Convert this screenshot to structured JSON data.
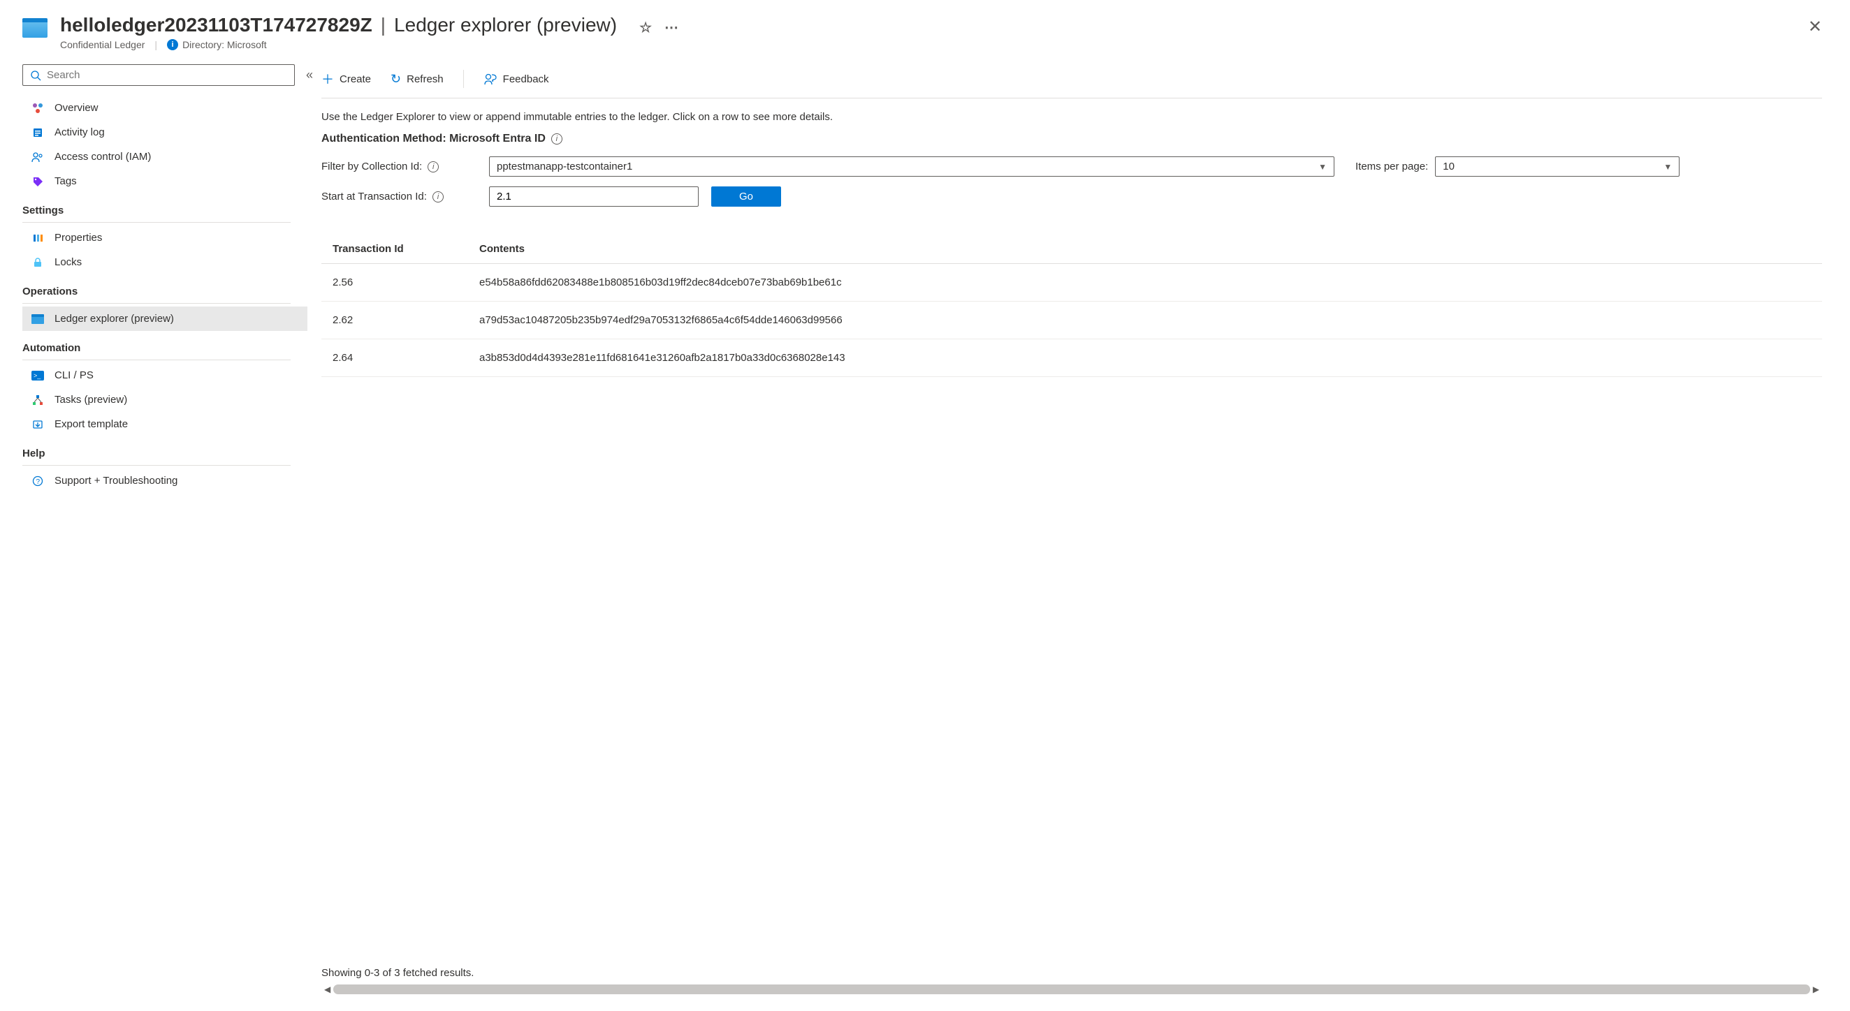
{
  "header": {
    "resource_name": "helloledger20231103T174727829Z",
    "page_name": "Ledger explorer (preview)",
    "resource_type": "Confidential Ledger",
    "directory_label": "Directory: Microsoft"
  },
  "sidebar": {
    "search_placeholder": "Search",
    "items_top": [
      {
        "label": "Overview"
      },
      {
        "label": "Activity log"
      },
      {
        "label": "Access control (IAM)"
      },
      {
        "label": "Tags"
      }
    ],
    "section_settings": "Settings",
    "items_settings": [
      {
        "label": "Properties"
      },
      {
        "label": "Locks"
      }
    ],
    "section_operations": "Operations",
    "items_operations": [
      {
        "label": "Ledger explorer (preview)"
      }
    ],
    "section_automation": "Automation",
    "items_automation": [
      {
        "label": "CLI / PS"
      },
      {
        "label": "Tasks (preview)"
      },
      {
        "label": "Export template"
      }
    ],
    "section_help": "Help",
    "items_help": [
      {
        "label": "Support + Troubleshooting"
      }
    ]
  },
  "toolbar": {
    "create": "Create",
    "refresh": "Refresh",
    "feedback": "Feedback"
  },
  "main": {
    "description": "Use the Ledger Explorer to view or append immutable entries to the ledger. Click on a row to see more details.",
    "auth_label": "Authentication Method: Microsoft Entra ID",
    "filter_collection_label": "Filter by Collection Id:",
    "filter_collection_value": "pptestmanapp-testcontainer1",
    "items_per_page_label": "Items per page:",
    "items_per_page_value": "10",
    "start_tx_label": "Start at Transaction Id:",
    "start_tx_value": "2.1",
    "go_label": "Go",
    "col_txid": "Transaction Id",
    "col_contents": "Contents",
    "rows": [
      {
        "txid": "2.56",
        "contents": "e54b58a86fdd62083488e1b808516b03d19ff2dec84dceb07e73bab69b1be61c"
      },
      {
        "txid": "2.62",
        "contents": "a79d53ac10487205b235b974edf29a7053132f6865a4c6f54dde146063d99566"
      },
      {
        "txid": "2.64",
        "contents": "a3b853d0d4d4393e281e11fd681641e31260afb2a1817b0a33d0c6368028e143"
      }
    ],
    "status": "Showing 0-3 of 3 fetched results."
  }
}
